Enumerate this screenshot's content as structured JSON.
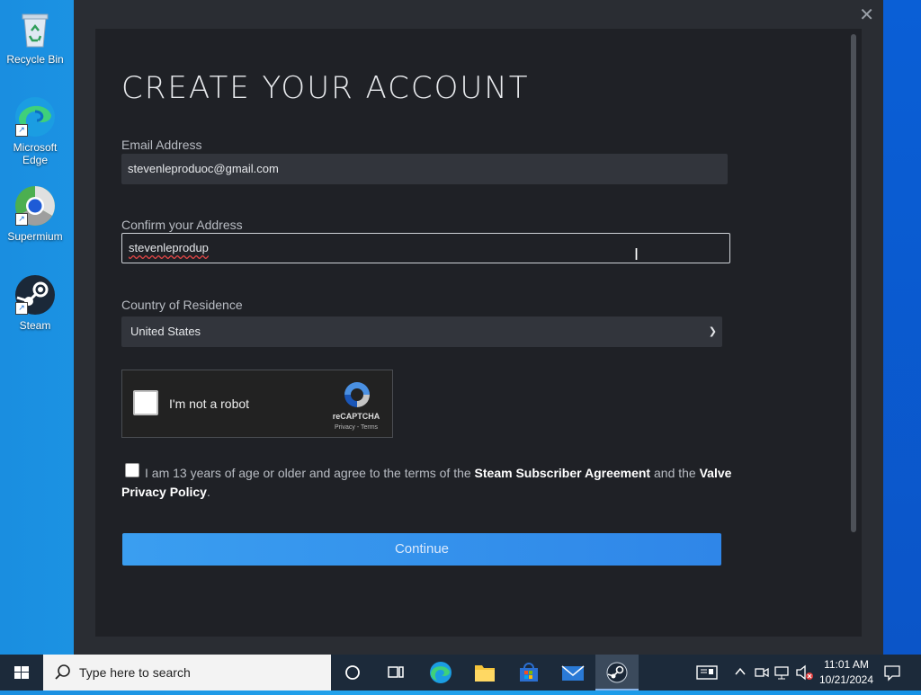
{
  "desktop": {
    "icons": [
      {
        "label": "Recycle Bin"
      },
      {
        "label": "Microsoft Edge"
      },
      {
        "label": "Supermium"
      },
      {
        "label": "Steam"
      }
    ]
  },
  "window": {
    "close_symbol": "✕"
  },
  "form": {
    "title": "CREATE YOUR ACCOUNT",
    "email_label": "Email Address",
    "email_value": "stevenleproduoc@gmail.com",
    "confirm_label": "Confirm your Address",
    "confirm_value": "stevenleprodup",
    "country_label": "Country of Residence",
    "country_value": "United States",
    "captcha": {
      "text": "I'm not a robot",
      "brand": "reCAPTCHA",
      "links": "Privacy - Terms"
    },
    "agreement": {
      "prefix": "I am 13 years of age or older and agree to the terms of the ",
      "link1": "Steam Subscriber Agreement",
      "middle": " and the ",
      "link2": "Valve Privacy Policy",
      "suffix": "."
    },
    "continue_label": "Continue"
  },
  "taskbar": {
    "search_placeholder": "Type here to search",
    "apps": [
      "task-view",
      "edge",
      "file-explorer",
      "microsoft-store",
      "mail",
      "steam"
    ],
    "time": "11:01 AM",
    "date": "10/21/2024"
  },
  "colors": {
    "panel_bg": "#1f2126",
    "field_bg": "#32353c",
    "accent": "#3a9ef0",
    "taskbar": "#1c2a3a"
  }
}
